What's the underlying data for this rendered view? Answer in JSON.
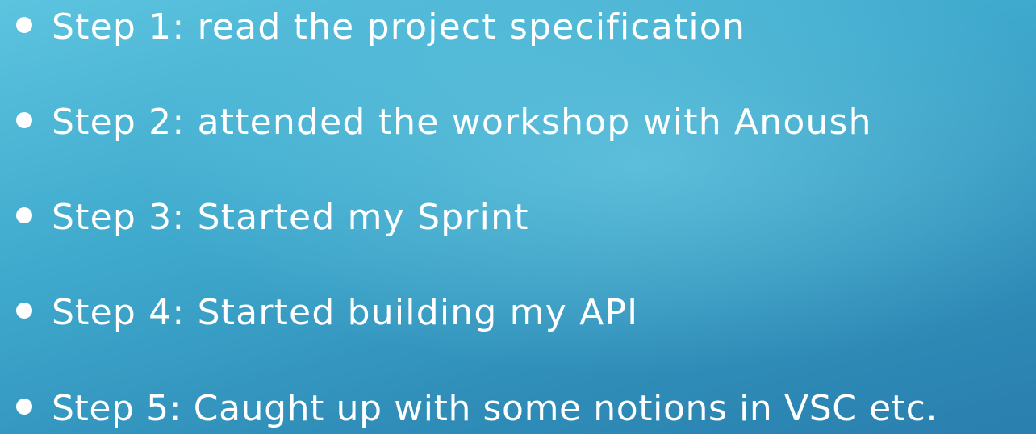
{
  "slide": {
    "bullets": [
      {
        "text": "Step 1: read the project specification"
      },
      {
        "text": "Step 2: attended the workshop with Anoush"
      },
      {
        "text": "Step 3: Started my Sprint"
      },
      {
        "text": "Step 4: Started building my API"
      },
      {
        "text": "Step 5: Caught up with some notions in VSC etc."
      }
    ]
  },
  "colors": {
    "background_light": "#5cc4df",
    "background_dark": "#2a7fae",
    "text": "#ffffff"
  }
}
